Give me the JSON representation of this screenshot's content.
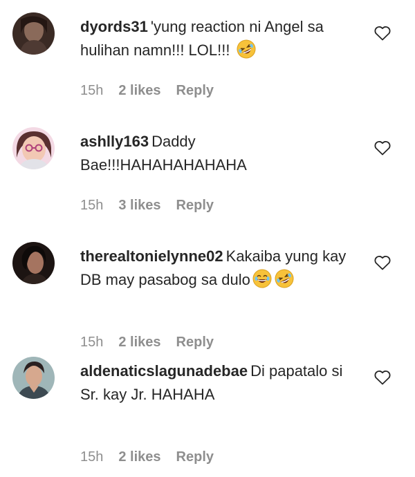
{
  "comments": [
    {
      "username": "dyords31",
      "text": "'yung reaction ni Angel sa hulihan namn!!! LOL!!!",
      "emojis": [
        "rofl-emoji"
      ],
      "time": "15h",
      "likes": "2 likes",
      "reply": "Reply"
    },
    {
      "username": "ashlly163",
      "text": "Daddy Bae!!!HAHAHAHAHAHA",
      "emojis": [],
      "time": "15h",
      "likes": "3 likes",
      "reply": "Reply"
    },
    {
      "username": "therealtonielynne02",
      "text": "Kakaiba yung kay DB may pasabog sa dulo",
      "emojis": [
        "joy-emoji",
        "rofl-emoji"
      ],
      "time": "15h",
      "likes": "2 likes",
      "reply": "Reply"
    },
    {
      "username": "aldenaticslagunadebae",
      "text": "Di papatalo si Sr. kay Jr. HAHAHA",
      "emojis": [],
      "time": "15h",
      "likes": "2 likes",
      "reply": "Reply"
    }
  ],
  "colors": {
    "text": "#262626",
    "meta": "#8e8e8e",
    "emoji_face": "#f7c23a"
  },
  "icons": {
    "like": "heart-outline-icon"
  }
}
